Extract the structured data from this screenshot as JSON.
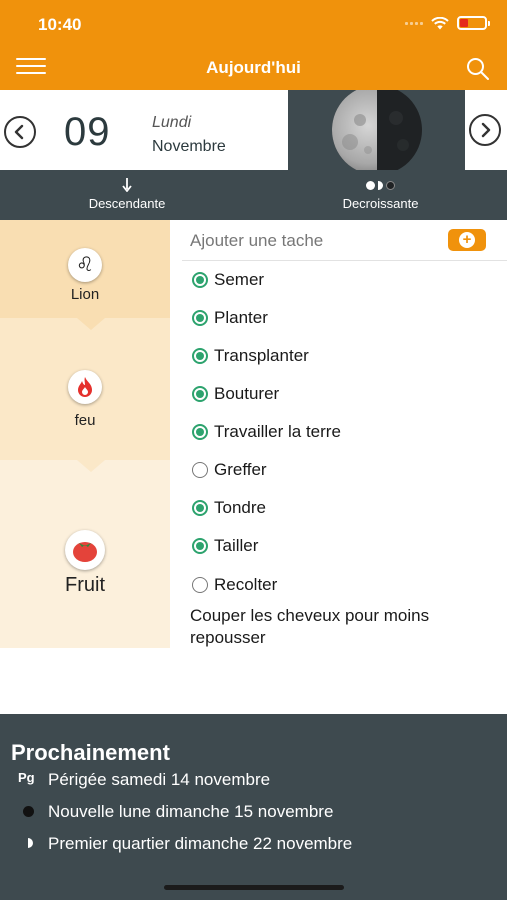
{
  "status": {
    "time": "10:40"
  },
  "header": {
    "title": "Aujourd'hui"
  },
  "date": {
    "day_num": "09",
    "day_name": "Lundi",
    "month": "Novembre"
  },
  "info": {
    "left_label": "Descendante",
    "right_label": "Decroissante"
  },
  "zodiac": {
    "sign": "Lion",
    "element": "feu",
    "type": "Fruit"
  },
  "tasks": {
    "add_placeholder": "Ajouter une tache",
    "items": [
      {
        "label": "Semer",
        "checked": true
      },
      {
        "label": "Planter",
        "checked": true
      },
      {
        "label": "Transplanter",
        "checked": true
      },
      {
        "label": "Bouturer",
        "checked": true
      },
      {
        "label": "Travailler la terre",
        "checked": true
      },
      {
        "label": "Greffer",
        "checked": false
      },
      {
        "label": "Tondre",
        "checked": true
      },
      {
        "label": "Tailler",
        "checked": true
      },
      {
        "label": "Recolter",
        "checked": false
      }
    ],
    "extra": "Couper les cheveux pour moins repousser"
  },
  "upcoming": {
    "title": "Prochainement",
    "events": [
      {
        "icon": "Pg",
        "text": "Périgée samedi 14 novembre"
      },
      {
        "icon": "new-moon-icon",
        "text": "Nouvelle lune dimanche 15 novembre"
      },
      {
        "icon": "first-quarter-icon",
        "text": "Premier quartier dimanche 22 novembre"
      }
    ]
  },
  "colors": {
    "accent": "#f0920c",
    "dark": "#3e4a4f",
    "green": "#2da36e"
  }
}
